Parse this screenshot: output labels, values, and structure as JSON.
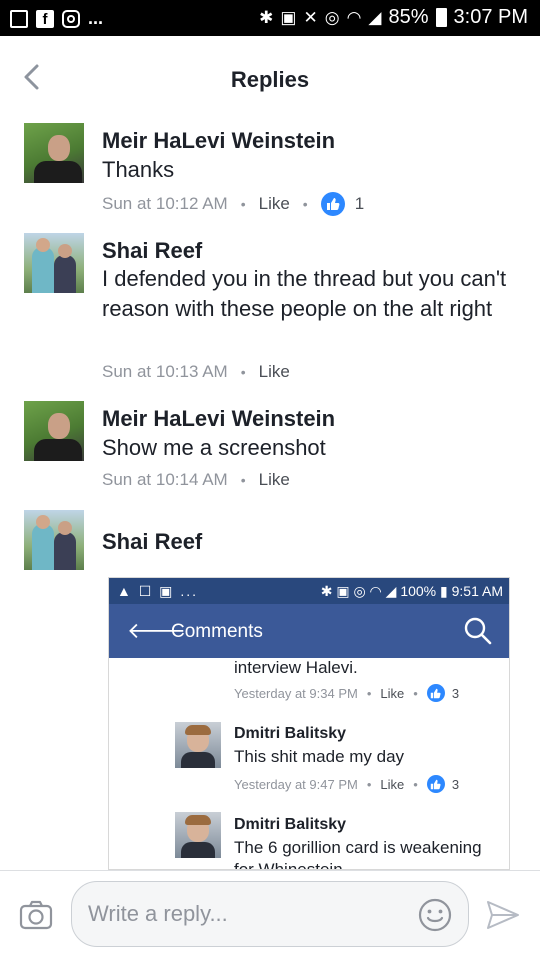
{
  "status_bar": {
    "battery": "85%",
    "time": "3:07 PM",
    "overflow": "..."
  },
  "header": {
    "title": "Replies"
  },
  "comments": [
    {
      "author": "Meir HaLevi Weinstein",
      "text": "Thanks",
      "time": "Sun at 10:12 AM",
      "like_label": "Like",
      "reactions": "1"
    },
    {
      "author": "Shai Reef",
      "text": "I defended you in the thread but you can't reason with these people on the alt right",
      "time": "Sun at 10:13 AM",
      "like_label": "Like"
    },
    {
      "author": "Meir HaLevi Weinstein",
      "text": "Show me a screenshot",
      "time": "Sun at 10:14 AM",
      "like_label": "Like"
    },
    {
      "author": "Shai Reef"
    }
  ],
  "screenshot": {
    "status": {
      "overflow": "...",
      "battery": "100%",
      "time": "9:51 AM"
    },
    "title": "Comments",
    "prev_text": "interview Halevi.",
    "prev_time": "Yesterday at 9:34 PM",
    "prev_like": "Like",
    "prev_reactions": "3",
    "comments": [
      {
        "author": "Dmitri Balitsky",
        "text": "This shit made my day",
        "time": "Yesterday at 9:47 PM",
        "like_label": "Like",
        "reactions": "3"
      },
      {
        "author": "Dmitri Balitsky",
        "text": "The 6 gorillion card is weakening",
        "text_cut": "for Whinestein"
      }
    ]
  },
  "composer": {
    "placeholder": "Write a reply..."
  },
  "colors": {
    "like_blue": "#2d88ff",
    "fb_blue": "#3b5998",
    "status_blue": "#29487d"
  }
}
